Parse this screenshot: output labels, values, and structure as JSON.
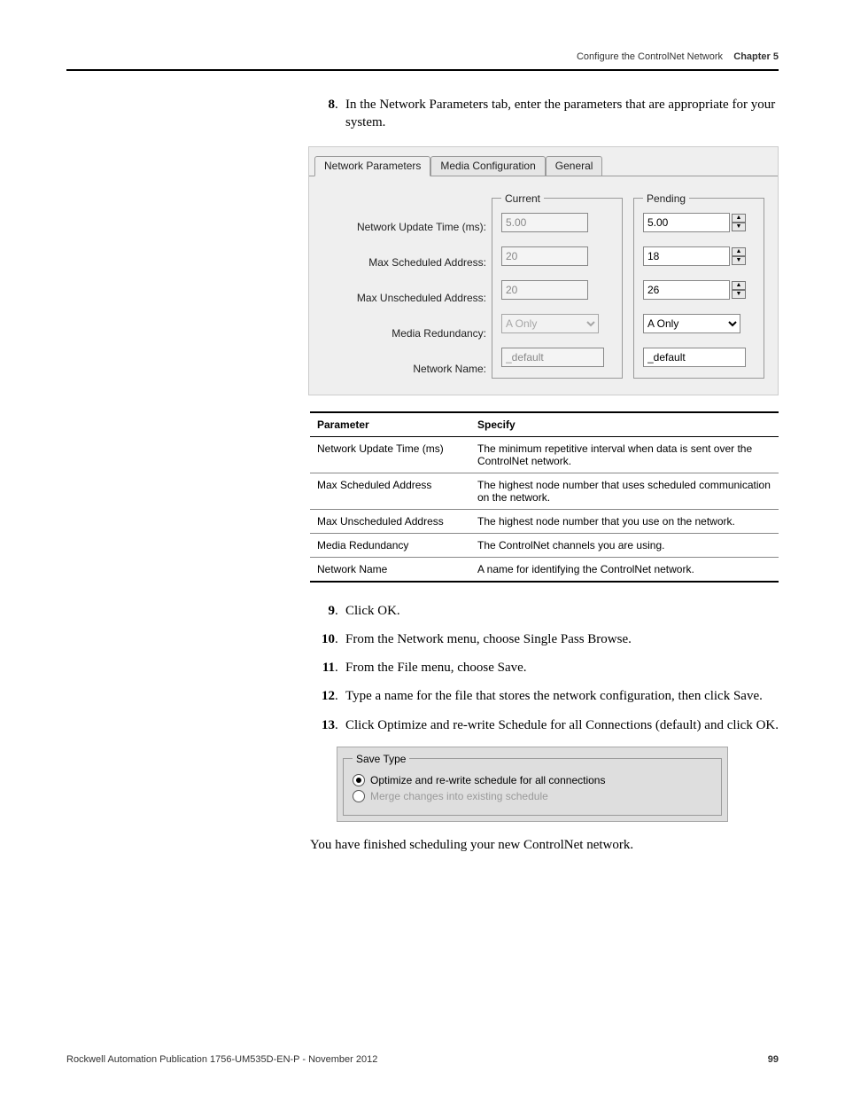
{
  "header": {
    "title": "Configure the ControlNet Network",
    "chapter": "Chapter 5"
  },
  "steps": {
    "s8": "In the Network Parameters tab, enter the parameters that are appropriate for your system.",
    "s9": "Click OK.",
    "s10": "From the Network menu, choose Single Pass Browse.",
    "s11": "From the File menu, choose Save.",
    "s12": "Type a name for the file that stores the network configuration, then click Save.",
    "s13": "Click Optimize and re-write Schedule for all Connections (default) and click OK."
  },
  "dialog": {
    "tabs": [
      "Network Parameters",
      "Media Configuration",
      "General"
    ],
    "labels": {
      "nut": "Network Update Time (ms):",
      "msa": "Max Scheduled Address:",
      "mua": "Max Unscheduled Address:",
      "mr": "Media Redundancy:",
      "nn": "Network Name:"
    },
    "current": {
      "legend": "Current",
      "nut": "5.00",
      "msa": "20",
      "mua": "20",
      "mr": "A Only",
      "nn": "_default"
    },
    "pending": {
      "legend": "Pending",
      "nut": "5.00",
      "msa": "18",
      "mua": "26",
      "mr": "A Only",
      "nn": "_default"
    }
  },
  "table": {
    "head": {
      "c1": "Parameter",
      "c2": "Specify"
    },
    "rows": [
      {
        "p": "Network Update Time (ms)",
        "s": "The minimum repetitive interval when data is sent over the ControlNet network."
      },
      {
        "p": "Max Scheduled Address",
        "s": "The highest node number that uses scheduled communication on the network."
      },
      {
        "p": "Max Unscheduled Address",
        "s": "The highest node number that you use on the network."
      },
      {
        "p": "Media Redundancy",
        "s": "The ControlNet channels you are using."
      },
      {
        "p": "Network Name",
        "s": "A name for identifying the ControlNet network."
      }
    ]
  },
  "savebox": {
    "legend": "Save Type",
    "opt1": "Optimize and re-write schedule for all connections",
    "opt2": "Merge changes into existing schedule"
  },
  "closing": "You have finished scheduling your new ControlNet network.",
  "footer": {
    "pub": "Rockwell Automation Publication 1756-UM535D-EN-P - November 2012",
    "page": "99"
  }
}
